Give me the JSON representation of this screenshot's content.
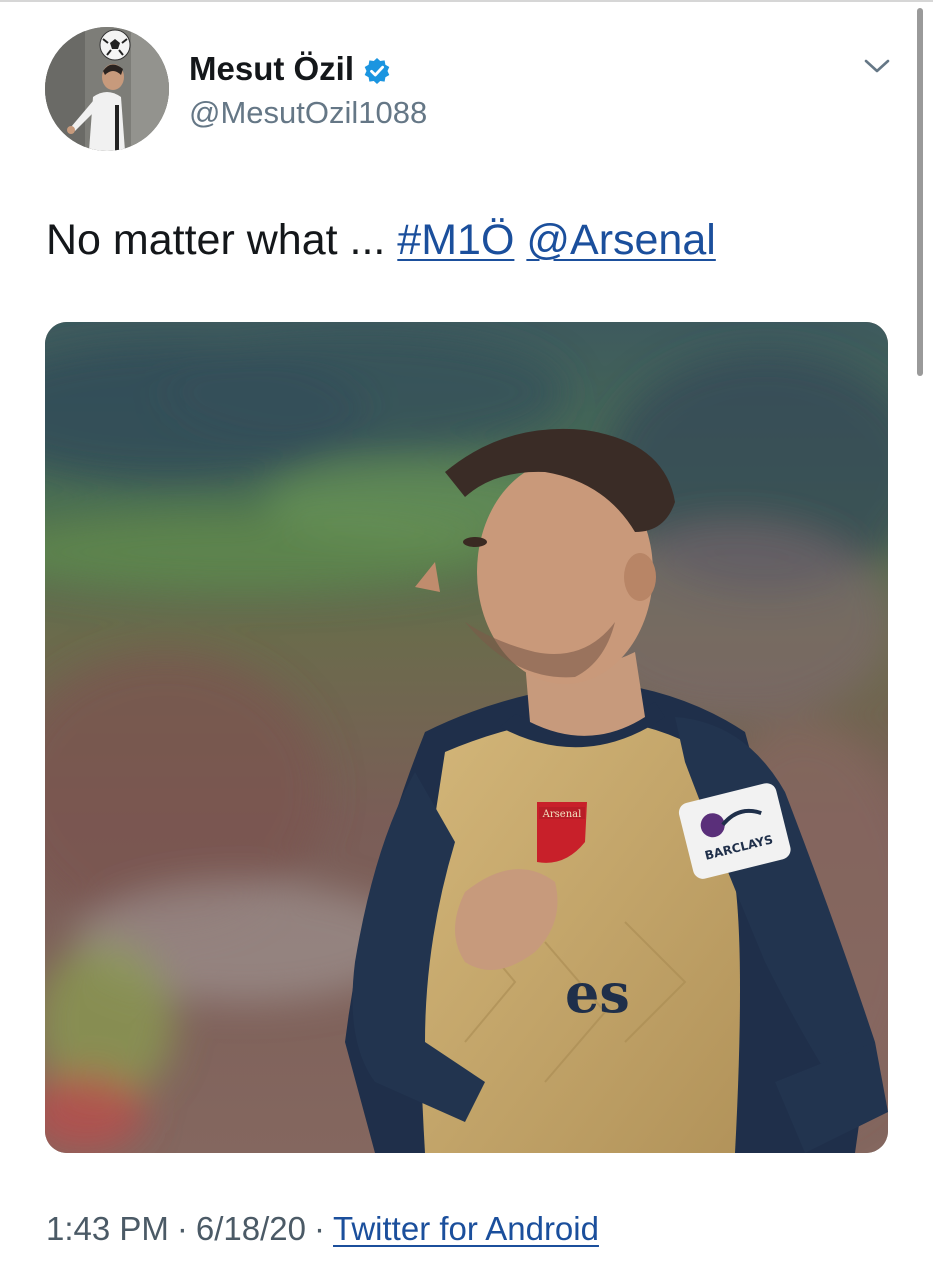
{
  "tweet": {
    "author": {
      "display_name": "Mesut Özil",
      "handle": "@MesutOzil1088",
      "verified": true
    },
    "text_plain": "No matter what ... ",
    "hashtag": "#M1Ö",
    "mention": "@Arsenal",
    "meta": {
      "time": "1:43 PM",
      "date": "6/18/20",
      "separator": "·",
      "source": "Twitter for Android"
    },
    "media_alt": "Photo of player in Arsenal away kit with hand on club badge"
  },
  "kit_text": {
    "badge": "Arsenal",
    "sponsor": "es",
    "sleeve_patch": "BARCLAYS"
  },
  "colors": {
    "link": "#1b4f9c",
    "verified_badge": "#1b95e0",
    "secondary_text": "#657786",
    "kit_gold": "#c6a869",
    "kit_navy": "#1f2f4a"
  },
  "icons": {
    "verified": "verified-badge-icon",
    "more": "chevron-down-icon"
  }
}
